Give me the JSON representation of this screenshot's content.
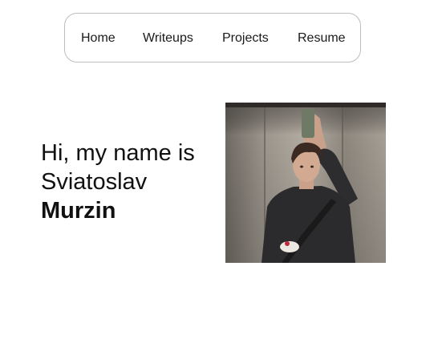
{
  "nav": {
    "items": [
      {
        "label": "Home"
      },
      {
        "label": "Writeups"
      },
      {
        "label": "Projects"
      },
      {
        "label": "Resume"
      }
    ]
  },
  "hero": {
    "line1": "Hi, my name is",
    "line2": "Sviatoslav",
    "name": "Murzin"
  },
  "photo": {
    "description_icon": "profile-photo"
  }
}
